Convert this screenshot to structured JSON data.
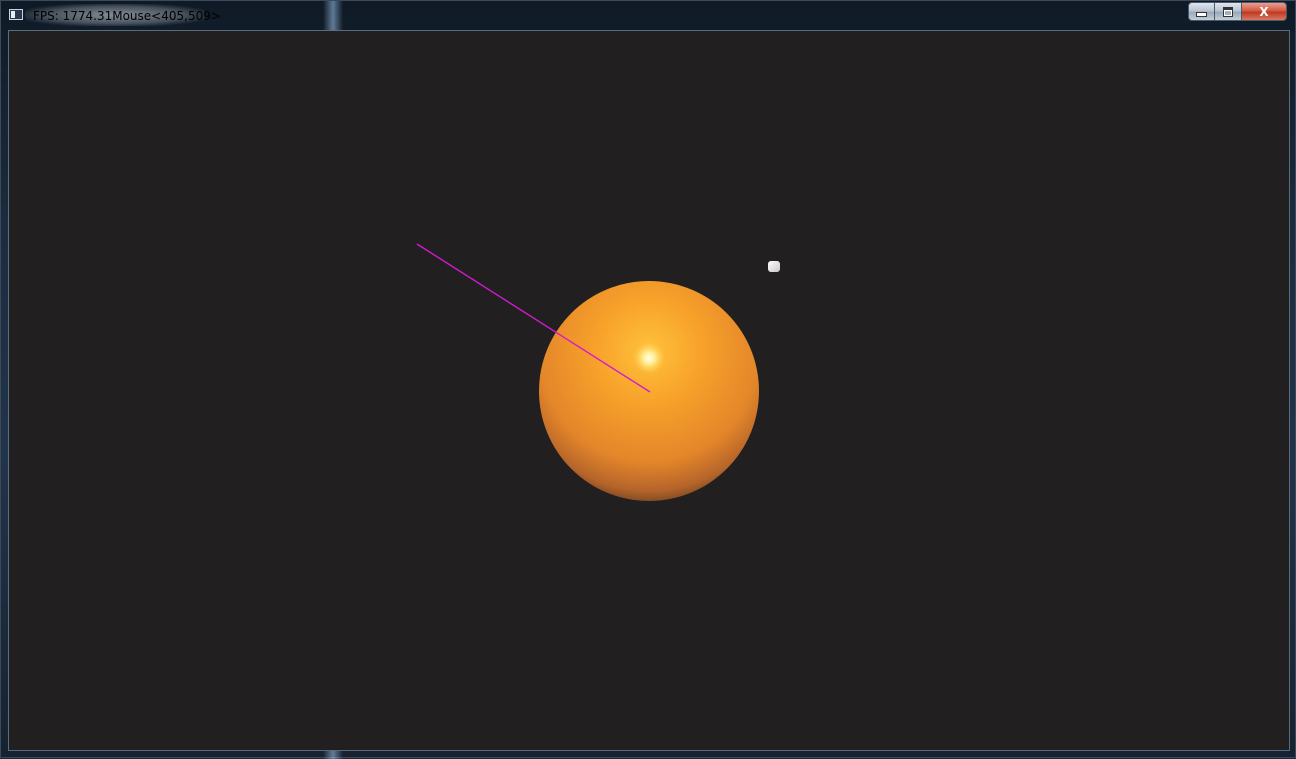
{
  "window": {
    "title": "FPS: 1774.31Mouse<405,509>"
  },
  "caption_buttons": {
    "minimize_icon": "minimize-icon",
    "maximize_icon": "maximize-icon",
    "close_label": "X"
  },
  "scene": {
    "background_color": "#221f20",
    "sphere": {
      "color": "#f39a2a",
      "highlight_color": "#fff6b0",
      "shadow_color": "#5e3a20"
    },
    "ray_line_color": "#d21ad2",
    "light_marker_color": "#ffffff"
  }
}
